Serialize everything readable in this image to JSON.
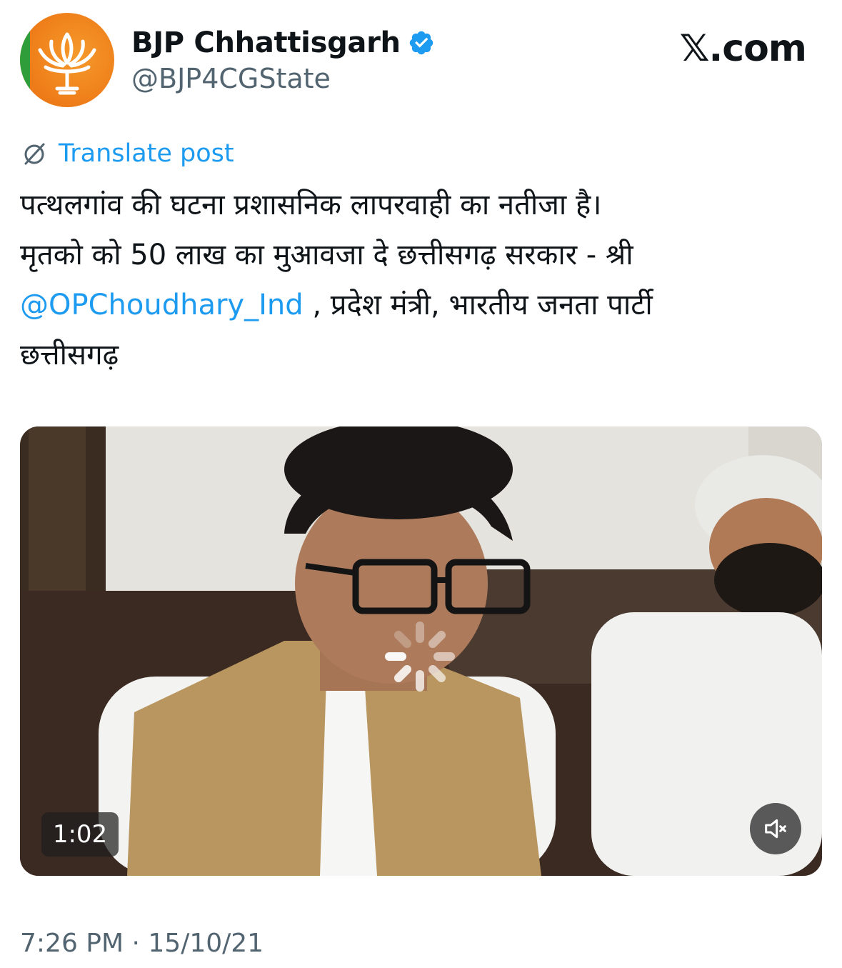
{
  "author": {
    "display_name": "BJP Chhattisgarh",
    "handle": "@BJP4CGState",
    "verified": true
  },
  "site_logo": "𝕏.com",
  "translate": {
    "label": "Translate post"
  },
  "post": {
    "line1": "पत्थलगांव की घटना प्रशासनिक लापरवाही का नतीजा है।",
    "line2": "मृतको को 50 लाख का मुआवजा दे छत्तीसगढ़ सरकार - श्री",
    "mention": "@OPChoudhary_Ind",
    "line3_rest": " , प्रदेश मंत्री, भारतीय जनता पार्टी",
    "line4": "छत्तीसगढ़"
  },
  "video": {
    "duration": "1:02",
    "muted": true
  },
  "timestamp": "7:26 PM · 15/10/21",
  "colors": {
    "link": "#1d9bf0",
    "secondary_text": "#536471",
    "primary_text": "#0f1419",
    "brand_orange": "#ef7f1a",
    "brand_green": "#2f9e3a"
  },
  "icons": {
    "verified": "verified-badge-icon",
    "translate": "globe-slash-icon",
    "loading": "spinner-icon",
    "mute": "speaker-muted-icon"
  }
}
